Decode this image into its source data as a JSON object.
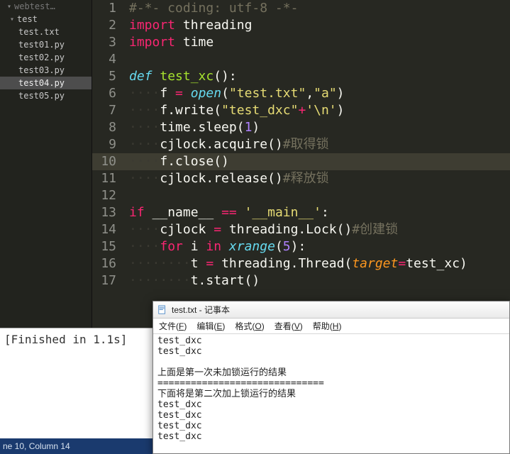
{
  "sidebar": {
    "root": "webtest…",
    "folder": "test",
    "files": [
      "test.txt",
      "test01.py",
      "test02.py",
      "test03.py",
      "test04.py",
      "test05.py"
    ],
    "selected_index": 4
  },
  "editor": {
    "current_line_index": 9,
    "lines": [
      {
        "n": 1,
        "ws": "",
        "seg": [
          [
            "cmt",
            "#-*- coding: utf-8 -*-"
          ]
        ]
      },
      {
        "n": 2,
        "ws": "",
        "seg": [
          [
            "k-import",
            "import"
          ],
          [
            "",
            " threading"
          ]
        ]
      },
      {
        "n": 3,
        "ws": "",
        "seg": [
          [
            "k-import",
            "import"
          ],
          [
            "",
            " time"
          ]
        ]
      },
      {
        "n": 4,
        "ws": "",
        "seg": []
      },
      {
        "n": 5,
        "ws": "",
        "seg": [
          [
            "k-def",
            "def"
          ],
          [
            "",
            " "
          ],
          [
            "fn-name",
            "test_xc"
          ],
          [
            "",
            "():"
          ]
        ]
      },
      {
        "n": 6,
        "ws": "····",
        "seg": [
          [
            "",
            "f "
          ],
          [
            "op",
            "="
          ],
          [
            "",
            " "
          ],
          [
            "builtin",
            "open"
          ],
          [
            "",
            "("
          ],
          [
            "str",
            "\"test.txt\""
          ],
          [
            "",
            ","
          ],
          [
            "str",
            "\"a\""
          ],
          [
            "",
            ")"
          ]
        ]
      },
      {
        "n": 7,
        "ws": "····",
        "seg": [
          [
            "",
            "f.write("
          ],
          [
            "str",
            "\"test_dxc\""
          ],
          [
            "op",
            "+"
          ],
          [
            "str",
            "'\\n'"
          ],
          [
            "",
            ")"
          ]
        ]
      },
      {
        "n": 8,
        "ws": "····",
        "seg": [
          [
            "",
            "time.sleep("
          ],
          [
            "num",
            "1"
          ],
          [
            "",
            ")"
          ]
        ]
      },
      {
        "n": 9,
        "ws": "····",
        "seg": [
          [
            "",
            "cjlock.acquire()"
          ],
          [
            "cmt",
            "#取得锁"
          ]
        ]
      },
      {
        "n": 10,
        "ws": "····",
        "seg": [
          [
            "",
            "f.close()"
          ]
        ]
      },
      {
        "n": 11,
        "ws": "····",
        "seg": [
          [
            "",
            "cjlock.release()"
          ],
          [
            "cmt",
            "#释放锁"
          ]
        ]
      },
      {
        "n": 12,
        "ws": "",
        "seg": []
      },
      {
        "n": 13,
        "ws": "",
        "seg": [
          [
            "k-ctrl",
            "if"
          ],
          [
            "",
            " __name__ "
          ],
          [
            "op",
            "=="
          ],
          [
            "",
            " "
          ],
          [
            "str",
            "'__main__'"
          ],
          [
            "",
            ":"
          ]
        ]
      },
      {
        "n": 14,
        "ws": "····",
        "seg": [
          [
            "",
            "cjlock "
          ],
          [
            "op",
            "="
          ],
          [
            "",
            " threading.Lock()"
          ],
          [
            "cmt",
            "#创建锁"
          ]
        ]
      },
      {
        "n": 15,
        "ws": "····",
        "seg": [
          [
            "k-ctrl",
            "for"
          ],
          [
            "",
            " i "
          ],
          [
            "k-ctrl",
            "in"
          ],
          [
            "",
            " "
          ],
          [
            "builtin",
            "xrange"
          ],
          [
            "",
            "("
          ],
          [
            "num",
            "5"
          ],
          [
            "",
            "):"
          ]
        ]
      },
      {
        "n": 16,
        "ws": "········",
        "seg": [
          [
            "",
            "t "
          ],
          [
            "op",
            "="
          ],
          [
            "",
            " threading.Thread("
          ],
          [
            "arg",
            "target"
          ],
          [
            "op",
            "="
          ],
          [
            "",
            "test_xc)"
          ]
        ]
      },
      {
        "n": 17,
        "ws": "········",
        "seg": [
          [
            "",
            "t.start()"
          ]
        ]
      }
    ]
  },
  "console": {
    "text": "[Finished in 1.1s]"
  },
  "status": {
    "text": "ne 10, Column 14"
  },
  "notepad": {
    "title": "test.txt - 记事本",
    "menus": [
      {
        "label": "文件",
        "key": "F"
      },
      {
        "label": "编辑",
        "key": "E"
      },
      {
        "label": "格式",
        "key": "O"
      },
      {
        "label": "查看",
        "key": "V"
      },
      {
        "label": "帮助",
        "key": "H"
      }
    ],
    "body": "test_dxc\ntest_dxc\n\n上面是第一次未加锁运行的结果\n==============================\n下面将是第二次加上锁运行的结果\ntest_dxc\ntest_dxc\ntest_dxc\ntest_dxc"
  }
}
